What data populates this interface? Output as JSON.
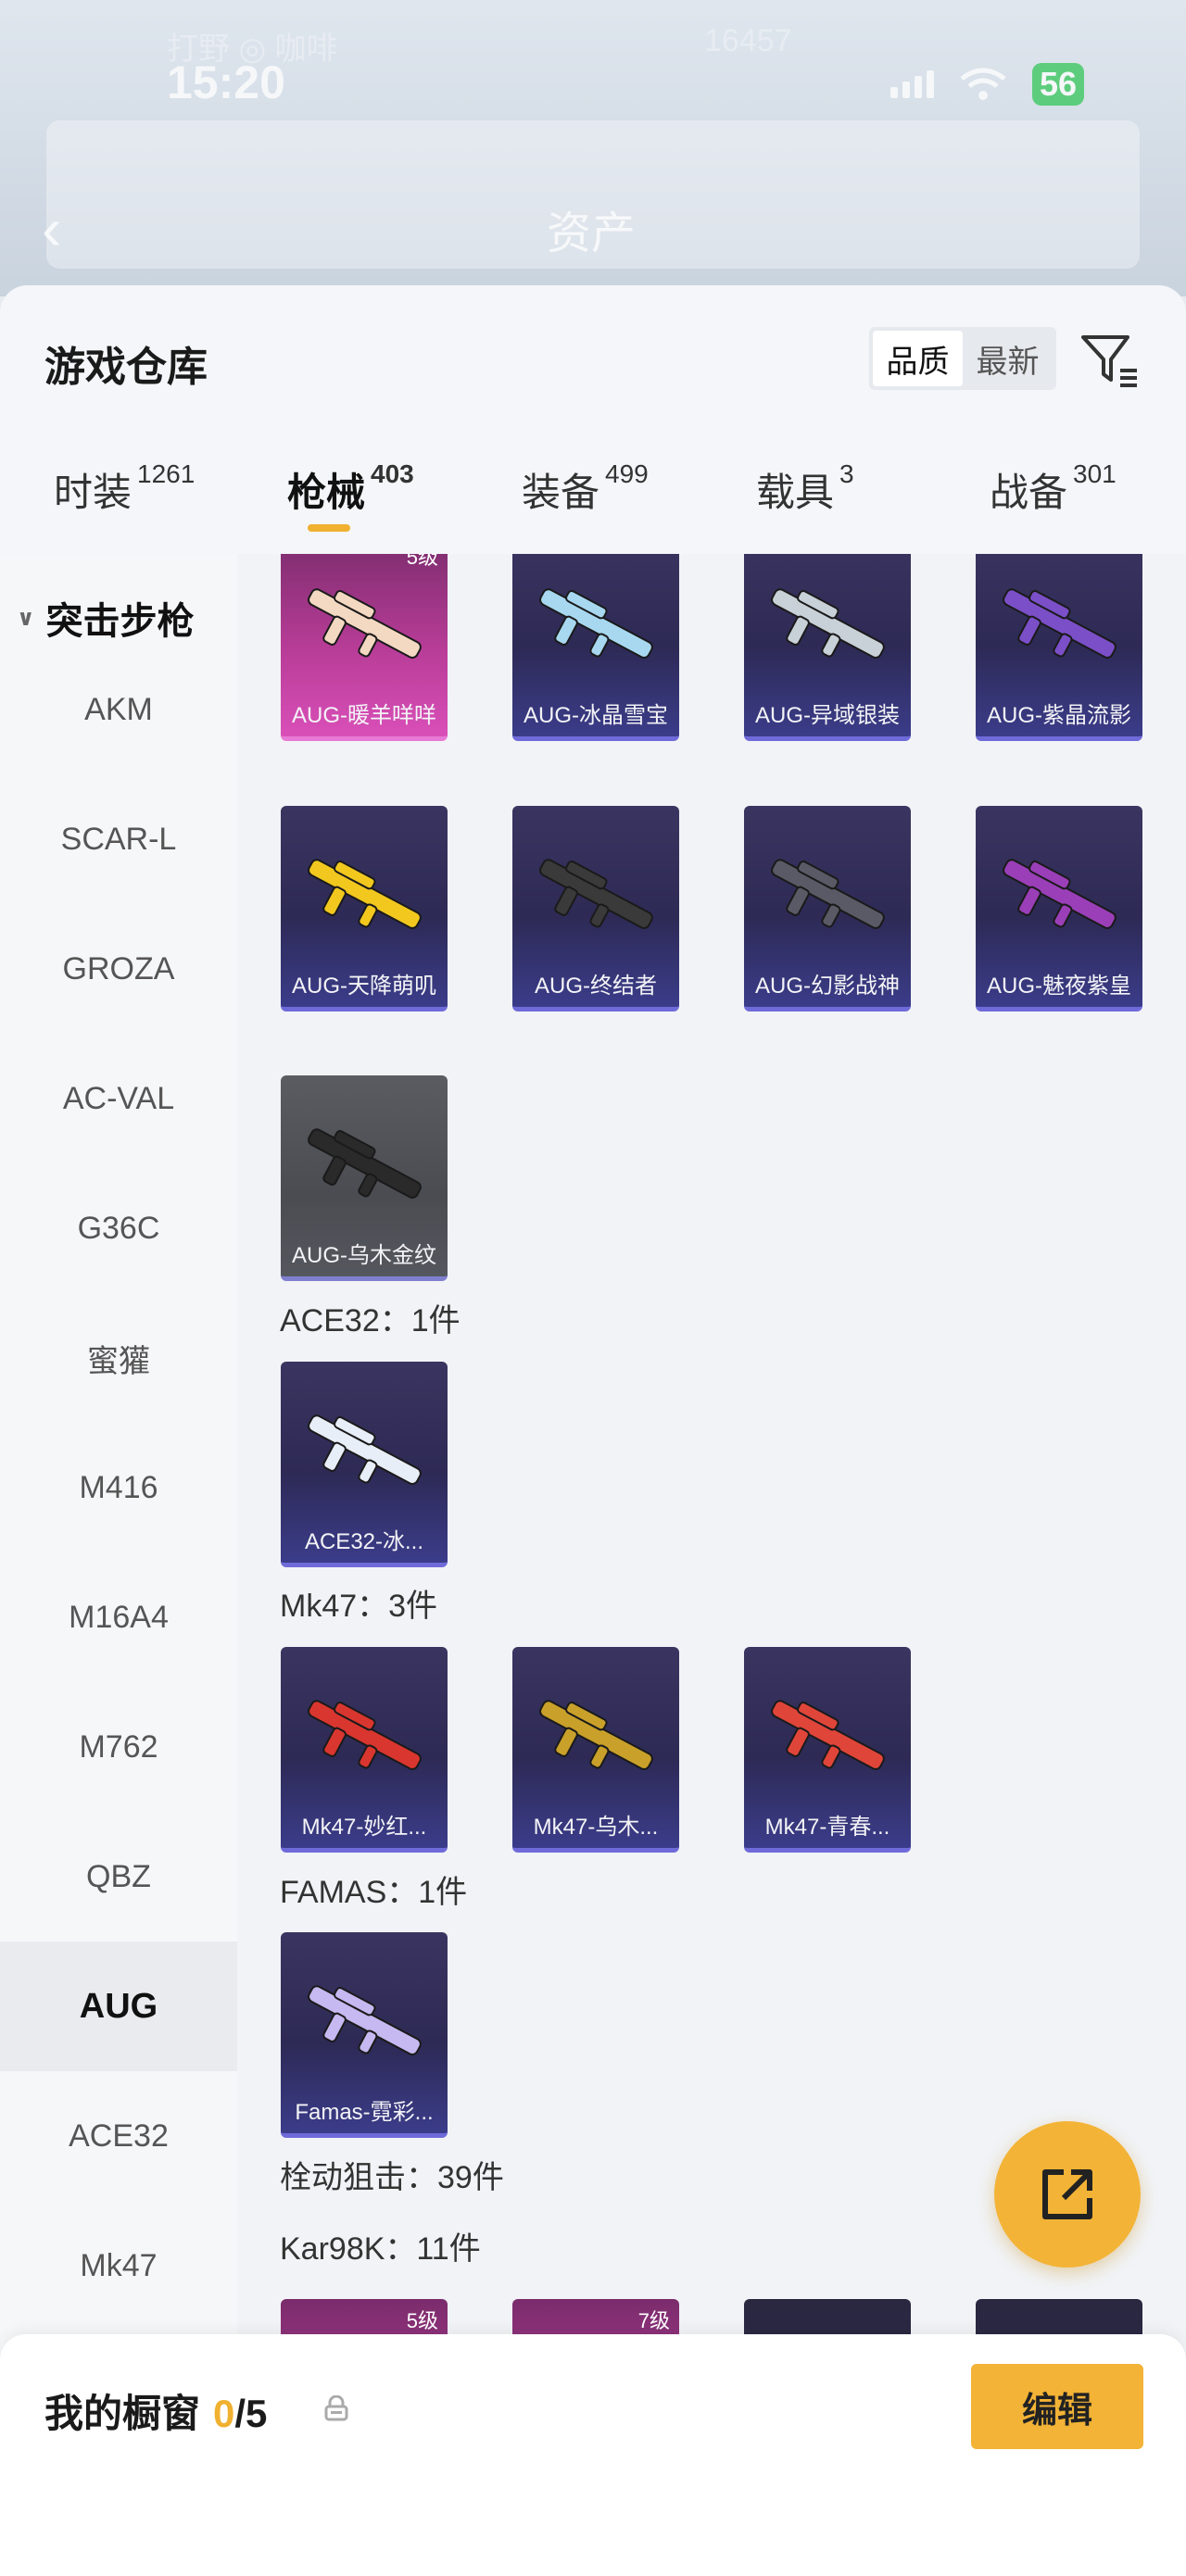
{
  "background": {
    "time": "15:20",
    "battery": "56",
    "faint_left": "打野  ◎ 咖啡",
    "faint_right": "16457",
    "title": "资产"
  },
  "sheet": {
    "title": "游戏仓库",
    "sort": [
      "品质",
      "最新"
    ],
    "sort_selected": "品质"
  },
  "tabs": [
    {
      "label": "时装",
      "count": "1261"
    },
    {
      "label": "枪械",
      "count": "403",
      "active": true
    },
    {
      "label": "装备",
      "count": "499"
    },
    {
      "label": "载具",
      "count": "3"
    },
    {
      "label": "战备",
      "count": "301"
    }
  ],
  "sidebar": {
    "category": "突击步枪",
    "items": [
      "AKM",
      "SCAR-L",
      "GROZA",
      "AC-VAL",
      "G36C",
      "蜜獾",
      "M416",
      "M16A4",
      "M762",
      "QBZ",
      "AUG",
      "ACE32",
      "Mk47"
    ],
    "selected": "AUG"
  },
  "grid": {
    "aug_row1": [
      {
        "name": "AUG-暖羊咩咩",
        "level": "5级",
        "rarity": "pink",
        "color": "#f4d9c2"
      },
      {
        "name": "AUG-冰晶雪宝",
        "rarity": "purple",
        "color": "#a8d8f0"
      },
      {
        "name": "AUG-异域银装",
        "rarity": "purple",
        "color": "#c8d0d8"
      },
      {
        "name": "AUG-紫晶流影",
        "rarity": "purple",
        "color": "#7b4fc8"
      }
    ],
    "aug_row2": [
      {
        "name": "AUG-天降萌叽",
        "rarity": "purple",
        "color": "#f2c81f"
      },
      {
        "name": "AUG-终结者",
        "rarity": "purple",
        "color": "#3a3a3a"
      },
      {
        "name": "AUG-幻影战神",
        "rarity": "purple",
        "color": "#5a5a66"
      },
      {
        "name": "AUG-魅夜紫皇",
        "rarity": "purple",
        "color": "#9a3fb8"
      }
    ],
    "aug_row3": [
      {
        "name": "AUG-乌木金纹",
        "rarity": "gray",
        "color": "#2a2a2a"
      }
    ],
    "ace32_label": "ACE32：1件",
    "ace32": [
      {
        "name": "ACE32-冰...",
        "rarity": "purple",
        "color": "#e8eef8"
      }
    ],
    "mk47_label": "Mk47：3件",
    "mk47": [
      {
        "name": "Mk47-妙红...",
        "rarity": "purple",
        "color": "#d9362f"
      },
      {
        "name": "Mk47-乌木...",
        "rarity": "purple",
        "color": "#c9a02a"
      },
      {
        "name": "Mk47-青春...",
        "rarity": "purple",
        "color": "#e0453a"
      }
    ],
    "famas_label": "FAMAS：1件",
    "famas": [
      {
        "name": "Famas-霓彩...",
        "rarity": "purple",
        "color": "#c6b8f0"
      }
    ],
    "bolt_label": "栓动狙击：39件",
    "kar98k_label": "Kar98K：11件",
    "kar98k_partial": [
      {
        "level": "5级",
        "rarity": "pink"
      },
      {
        "level": "7级",
        "rarity": "pink"
      },
      {
        "rarity": "dark"
      },
      {
        "rarity": "dark"
      }
    ]
  },
  "showcase": {
    "title": "我的橱窗",
    "current": "0",
    "total": "/5",
    "edit_label": "编辑"
  },
  "colors": {
    "accent": "#f3b336",
    "purple_card": "#3b3c8a",
    "pink_card": "#d94fb8"
  }
}
